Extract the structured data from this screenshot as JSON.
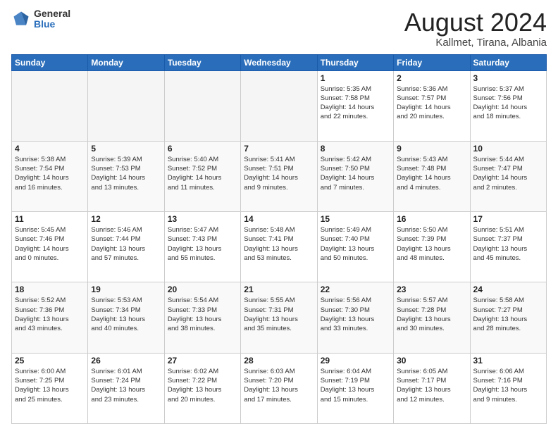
{
  "header": {
    "logo_general": "General",
    "logo_blue": "Blue",
    "main_title": "August 2024",
    "subtitle": "Kallmet, Tirana, Albania"
  },
  "calendar": {
    "headers": [
      "Sunday",
      "Monday",
      "Tuesday",
      "Wednesday",
      "Thursday",
      "Friday",
      "Saturday"
    ],
    "weeks": [
      [
        {
          "day": "",
          "info": ""
        },
        {
          "day": "",
          "info": ""
        },
        {
          "day": "",
          "info": ""
        },
        {
          "day": "",
          "info": ""
        },
        {
          "day": "1",
          "info": "Sunrise: 5:35 AM\nSunset: 7:58 PM\nDaylight: 14 hours\nand 22 minutes."
        },
        {
          "day": "2",
          "info": "Sunrise: 5:36 AM\nSunset: 7:57 PM\nDaylight: 14 hours\nand 20 minutes."
        },
        {
          "day": "3",
          "info": "Sunrise: 5:37 AM\nSunset: 7:56 PM\nDaylight: 14 hours\nand 18 minutes."
        }
      ],
      [
        {
          "day": "4",
          "info": "Sunrise: 5:38 AM\nSunset: 7:54 PM\nDaylight: 14 hours\nand 16 minutes."
        },
        {
          "day": "5",
          "info": "Sunrise: 5:39 AM\nSunset: 7:53 PM\nDaylight: 14 hours\nand 13 minutes."
        },
        {
          "day": "6",
          "info": "Sunrise: 5:40 AM\nSunset: 7:52 PM\nDaylight: 14 hours\nand 11 minutes."
        },
        {
          "day": "7",
          "info": "Sunrise: 5:41 AM\nSunset: 7:51 PM\nDaylight: 14 hours\nand 9 minutes."
        },
        {
          "day": "8",
          "info": "Sunrise: 5:42 AM\nSunset: 7:50 PM\nDaylight: 14 hours\nand 7 minutes."
        },
        {
          "day": "9",
          "info": "Sunrise: 5:43 AM\nSunset: 7:48 PM\nDaylight: 14 hours\nand 4 minutes."
        },
        {
          "day": "10",
          "info": "Sunrise: 5:44 AM\nSunset: 7:47 PM\nDaylight: 14 hours\nand 2 minutes."
        }
      ],
      [
        {
          "day": "11",
          "info": "Sunrise: 5:45 AM\nSunset: 7:46 PM\nDaylight: 14 hours\nand 0 minutes."
        },
        {
          "day": "12",
          "info": "Sunrise: 5:46 AM\nSunset: 7:44 PM\nDaylight: 13 hours\nand 57 minutes."
        },
        {
          "day": "13",
          "info": "Sunrise: 5:47 AM\nSunset: 7:43 PM\nDaylight: 13 hours\nand 55 minutes."
        },
        {
          "day": "14",
          "info": "Sunrise: 5:48 AM\nSunset: 7:41 PM\nDaylight: 13 hours\nand 53 minutes."
        },
        {
          "day": "15",
          "info": "Sunrise: 5:49 AM\nSunset: 7:40 PM\nDaylight: 13 hours\nand 50 minutes."
        },
        {
          "day": "16",
          "info": "Sunrise: 5:50 AM\nSunset: 7:39 PM\nDaylight: 13 hours\nand 48 minutes."
        },
        {
          "day": "17",
          "info": "Sunrise: 5:51 AM\nSunset: 7:37 PM\nDaylight: 13 hours\nand 45 minutes."
        }
      ],
      [
        {
          "day": "18",
          "info": "Sunrise: 5:52 AM\nSunset: 7:36 PM\nDaylight: 13 hours\nand 43 minutes."
        },
        {
          "day": "19",
          "info": "Sunrise: 5:53 AM\nSunset: 7:34 PM\nDaylight: 13 hours\nand 40 minutes."
        },
        {
          "day": "20",
          "info": "Sunrise: 5:54 AM\nSunset: 7:33 PM\nDaylight: 13 hours\nand 38 minutes."
        },
        {
          "day": "21",
          "info": "Sunrise: 5:55 AM\nSunset: 7:31 PM\nDaylight: 13 hours\nand 35 minutes."
        },
        {
          "day": "22",
          "info": "Sunrise: 5:56 AM\nSunset: 7:30 PM\nDaylight: 13 hours\nand 33 minutes."
        },
        {
          "day": "23",
          "info": "Sunrise: 5:57 AM\nSunset: 7:28 PM\nDaylight: 13 hours\nand 30 minutes."
        },
        {
          "day": "24",
          "info": "Sunrise: 5:58 AM\nSunset: 7:27 PM\nDaylight: 13 hours\nand 28 minutes."
        }
      ],
      [
        {
          "day": "25",
          "info": "Sunrise: 6:00 AM\nSunset: 7:25 PM\nDaylight: 13 hours\nand 25 minutes."
        },
        {
          "day": "26",
          "info": "Sunrise: 6:01 AM\nSunset: 7:24 PM\nDaylight: 13 hours\nand 23 minutes."
        },
        {
          "day": "27",
          "info": "Sunrise: 6:02 AM\nSunset: 7:22 PM\nDaylight: 13 hours\nand 20 minutes."
        },
        {
          "day": "28",
          "info": "Sunrise: 6:03 AM\nSunset: 7:20 PM\nDaylight: 13 hours\nand 17 minutes."
        },
        {
          "day": "29",
          "info": "Sunrise: 6:04 AM\nSunset: 7:19 PM\nDaylight: 13 hours\nand 15 minutes."
        },
        {
          "day": "30",
          "info": "Sunrise: 6:05 AM\nSunset: 7:17 PM\nDaylight: 13 hours\nand 12 minutes."
        },
        {
          "day": "31",
          "info": "Sunrise: 6:06 AM\nSunset: 7:16 PM\nDaylight: 13 hours\nand 9 minutes."
        }
      ]
    ]
  }
}
